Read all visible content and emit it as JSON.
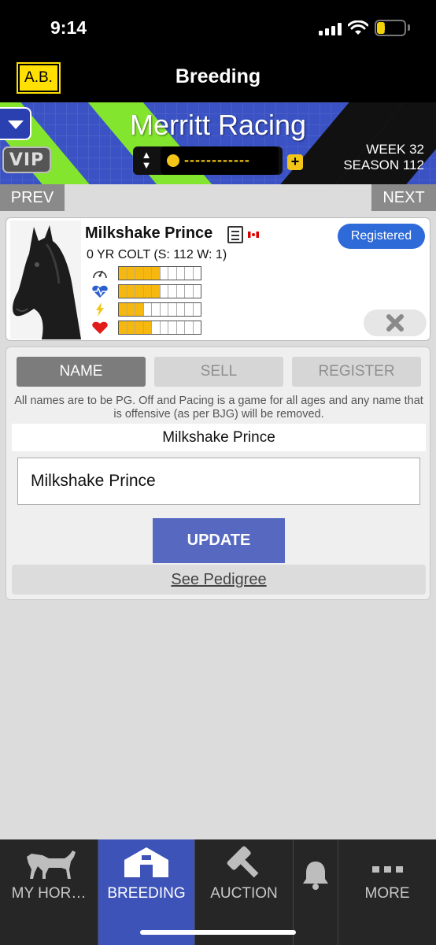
{
  "status_bar": {
    "time": "9:14",
    "battery": "19"
  },
  "nav": {
    "user_badge": "A.B.",
    "title": "Breeding"
  },
  "banner": {
    "stable_name": "Merritt Racing",
    "vip_label": "VIP",
    "coins_text": "------------",
    "plus_label": "+",
    "week": "WEEK 32",
    "season": "SEASON 112",
    "colors": {
      "blue": "#3a52c4",
      "green": "#84e52e",
      "black": "#111111"
    }
  },
  "pager": {
    "prev_label": "PREV",
    "next_label": "NEXT"
  },
  "horse": {
    "name": "Milkshake Prince",
    "description": "0 YR COLT (S: 112 W: 1)",
    "status_badge": "Registered",
    "flag": "canada-flag",
    "stats": [
      {
        "icon": "speedometer-icon",
        "filled": 5,
        "total": 10
      },
      {
        "icon": "heartbeat-icon",
        "filled": 5,
        "total": 10
      },
      {
        "icon": "lightning-icon",
        "filled": 3,
        "total": 10
      },
      {
        "icon": "heart-icon",
        "filled": 4,
        "total": 10
      }
    ]
  },
  "tabs": {
    "name": "NAME",
    "sell": "SELL",
    "register": "REGISTER",
    "active": "NAME"
  },
  "name_panel": {
    "notice": "All names are to be PG. Off and Pacing is a game for all ages and any name that is offensive (as per BJG) will be removed.",
    "current_name": "Milkshake Prince",
    "input_value": "Milkshake Prince",
    "update_label": "UPDATE",
    "pedigree_label": "See Pedigree"
  },
  "tabbar": {
    "items": [
      {
        "label": "MY HOR…",
        "icon": "horse-icon"
      },
      {
        "label": "BREEDING",
        "icon": "barn-icon",
        "active": true
      },
      {
        "label": "AUCTION",
        "icon": "gavel-icon"
      },
      {
        "label": "",
        "icon": "bell-icon"
      },
      {
        "label": "MORE",
        "icon": "more-icon"
      }
    ],
    "accent": "#3d53b8"
  }
}
